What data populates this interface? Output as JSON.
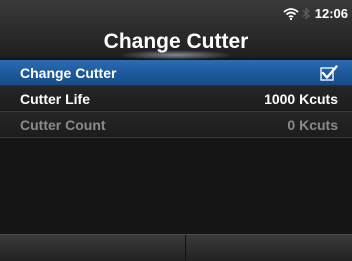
{
  "header": {
    "title": "Change Cutter",
    "time": "12:06",
    "wifi_icon": "wifi-icon",
    "bluetooth_icon": "bluetooth-icon"
  },
  "menu": {
    "items": [
      {
        "label": "Change Cutter",
        "value": "",
        "state": "selected",
        "indicator": "check-icon"
      },
      {
        "label": "Cutter Life",
        "value": "1000 Kcuts",
        "state": "normal"
      },
      {
        "label": "Cutter Count",
        "value": "0 Kcuts",
        "state": "disabled"
      }
    ]
  },
  "softkeys": {
    "left_label": "",
    "right_label": ""
  },
  "colors": {
    "selection": "#1e5a9e",
    "disabled_text": "#8a8a8a"
  }
}
